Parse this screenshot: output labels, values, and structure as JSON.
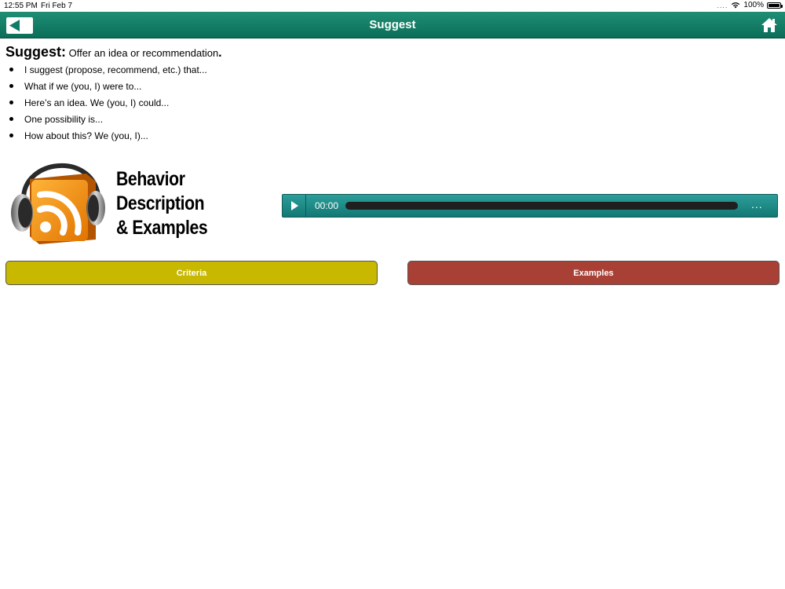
{
  "status_bar": {
    "time": "12:55 PM",
    "date": "Fri Feb 7",
    "signal": "....",
    "wifi_icon": "wifi-icon",
    "battery": "100%"
  },
  "navbar": {
    "title": "Suggest",
    "back_icon": "back-arrow-icon",
    "home_icon": "home-icon"
  },
  "content": {
    "heading_term": "Suggest:",
    "heading_desc": "Offer an idea or recommendation",
    "heading_end": ".",
    "bullets": [
      "I suggest (propose, recommend, etc.) that...",
      "What if we (you, I) were to...",
      "Here’s an idea. We (you, I) could...",
      "One possibility is...",
      "How about this? We (you, I)..."
    ]
  },
  "logo": {
    "line1": "Behavior",
    "line2": "Description",
    "line3": "& Examples",
    "icon": "rss-headphones-icon"
  },
  "player": {
    "time": "00:00",
    "more": "...",
    "progress": 0
  },
  "buttons": {
    "criteria": "Criteria",
    "examples": "Examples"
  },
  "colors": {
    "navbar": "#117d66",
    "player": "#1f8b87",
    "criteria": "#c8b800",
    "examples": "#a84036"
  }
}
